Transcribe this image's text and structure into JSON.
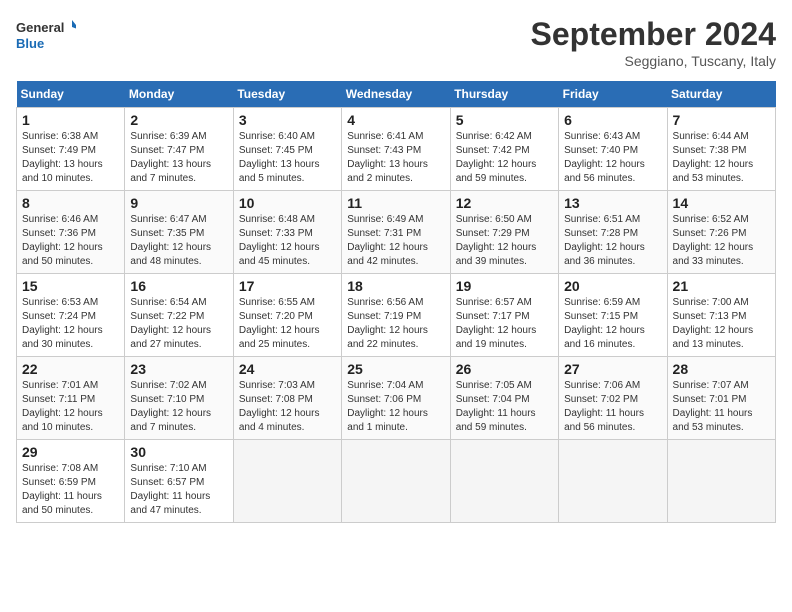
{
  "header": {
    "logo_line1": "General",
    "logo_line2": "Blue",
    "month_title": "September 2024",
    "location": "Seggiano, Tuscany, Italy"
  },
  "weekdays": [
    "Sunday",
    "Monday",
    "Tuesday",
    "Wednesday",
    "Thursday",
    "Friday",
    "Saturday"
  ],
  "weeks": [
    [
      {
        "day": "1",
        "sunrise": "6:38 AM",
        "sunset": "7:49 PM",
        "daylight": "13 hours and 10 minutes."
      },
      {
        "day": "2",
        "sunrise": "6:39 AM",
        "sunset": "7:47 PM",
        "daylight": "13 hours and 7 minutes."
      },
      {
        "day": "3",
        "sunrise": "6:40 AM",
        "sunset": "7:45 PM",
        "daylight": "13 hours and 5 minutes."
      },
      {
        "day": "4",
        "sunrise": "6:41 AM",
        "sunset": "7:43 PM",
        "daylight": "13 hours and 2 minutes."
      },
      {
        "day": "5",
        "sunrise": "6:42 AM",
        "sunset": "7:42 PM",
        "daylight": "12 hours and 59 minutes."
      },
      {
        "day": "6",
        "sunrise": "6:43 AM",
        "sunset": "7:40 PM",
        "daylight": "12 hours and 56 minutes."
      },
      {
        "day": "7",
        "sunrise": "6:44 AM",
        "sunset": "7:38 PM",
        "daylight": "12 hours and 53 minutes."
      }
    ],
    [
      {
        "day": "8",
        "sunrise": "6:46 AM",
        "sunset": "7:36 PM",
        "daylight": "12 hours and 50 minutes."
      },
      {
        "day": "9",
        "sunrise": "6:47 AM",
        "sunset": "7:35 PM",
        "daylight": "12 hours and 48 minutes."
      },
      {
        "day": "10",
        "sunrise": "6:48 AM",
        "sunset": "7:33 PM",
        "daylight": "12 hours and 45 minutes."
      },
      {
        "day": "11",
        "sunrise": "6:49 AM",
        "sunset": "7:31 PM",
        "daylight": "12 hours and 42 minutes."
      },
      {
        "day": "12",
        "sunrise": "6:50 AM",
        "sunset": "7:29 PM",
        "daylight": "12 hours and 39 minutes."
      },
      {
        "day": "13",
        "sunrise": "6:51 AM",
        "sunset": "7:28 PM",
        "daylight": "12 hours and 36 minutes."
      },
      {
        "day": "14",
        "sunrise": "6:52 AM",
        "sunset": "7:26 PM",
        "daylight": "12 hours and 33 minutes."
      }
    ],
    [
      {
        "day": "15",
        "sunrise": "6:53 AM",
        "sunset": "7:24 PM",
        "daylight": "12 hours and 30 minutes."
      },
      {
        "day": "16",
        "sunrise": "6:54 AM",
        "sunset": "7:22 PM",
        "daylight": "12 hours and 27 minutes."
      },
      {
        "day": "17",
        "sunrise": "6:55 AM",
        "sunset": "7:20 PM",
        "daylight": "12 hours and 25 minutes."
      },
      {
        "day": "18",
        "sunrise": "6:56 AM",
        "sunset": "7:19 PM",
        "daylight": "12 hours and 22 minutes."
      },
      {
        "day": "19",
        "sunrise": "6:57 AM",
        "sunset": "7:17 PM",
        "daylight": "12 hours and 19 minutes."
      },
      {
        "day": "20",
        "sunrise": "6:59 AM",
        "sunset": "7:15 PM",
        "daylight": "12 hours and 16 minutes."
      },
      {
        "day": "21",
        "sunrise": "7:00 AM",
        "sunset": "7:13 PM",
        "daylight": "12 hours and 13 minutes."
      }
    ],
    [
      {
        "day": "22",
        "sunrise": "7:01 AM",
        "sunset": "7:11 PM",
        "daylight": "12 hours and 10 minutes."
      },
      {
        "day": "23",
        "sunrise": "7:02 AM",
        "sunset": "7:10 PM",
        "daylight": "12 hours and 7 minutes."
      },
      {
        "day": "24",
        "sunrise": "7:03 AM",
        "sunset": "7:08 PM",
        "daylight": "12 hours and 4 minutes."
      },
      {
        "day": "25",
        "sunrise": "7:04 AM",
        "sunset": "7:06 PM",
        "daylight": "12 hours and 1 minute."
      },
      {
        "day": "26",
        "sunrise": "7:05 AM",
        "sunset": "7:04 PM",
        "daylight": "11 hours and 59 minutes."
      },
      {
        "day": "27",
        "sunrise": "7:06 AM",
        "sunset": "7:02 PM",
        "daylight": "11 hours and 56 minutes."
      },
      {
        "day": "28",
        "sunrise": "7:07 AM",
        "sunset": "7:01 PM",
        "daylight": "11 hours and 53 minutes."
      }
    ],
    [
      {
        "day": "29",
        "sunrise": "7:08 AM",
        "sunset": "6:59 PM",
        "daylight": "11 hours and 50 minutes."
      },
      {
        "day": "30",
        "sunrise": "7:10 AM",
        "sunset": "6:57 PM",
        "daylight": "11 hours and 47 minutes."
      },
      null,
      null,
      null,
      null,
      null
    ]
  ]
}
